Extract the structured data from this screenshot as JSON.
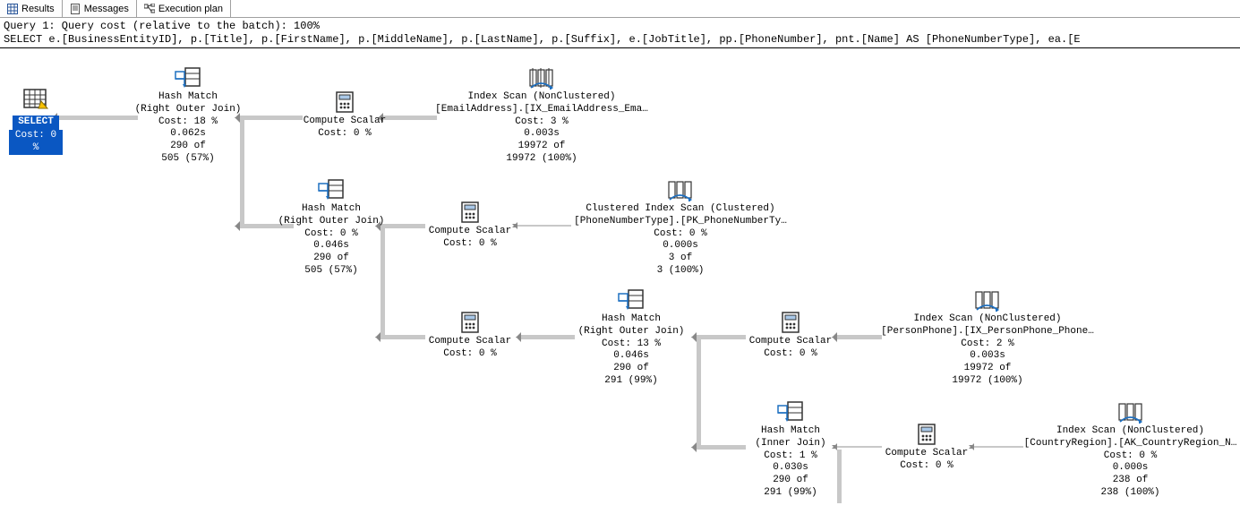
{
  "tabs": {
    "results": "Results",
    "messages": "Messages",
    "execution_plan": "Execution plan"
  },
  "header": {
    "line1": "Query 1: Query cost (relative to the batch): 100%",
    "line2": "SELECT e.[BusinessEntityID], p.[Title], p.[FirstName], p.[MiddleName], p.[LastName], p.[Suffix], e.[JobTitle], pp.[PhoneNumber], pnt.[Name] AS [PhoneNumberType], ea.[E"
  },
  "nodes": {
    "select": {
      "label": "SELECT",
      "cost": "Cost: 0 %"
    },
    "hm1": {
      "l1": "Hash Match",
      "l2": "(Right Outer Join)",
      "l3": "Cost: 18 %",
      "l4": "0.062s",
      "l5": "290 of",
      "l6": "505 (57%)"
    },
    "cs1": {
      "l1": "Compute Scalar",
      "l2": "Cost: 0 %"
    },
    "ixscan1": {
      "l1": "Index Scan (NonClustered)",
      "l2": "[EmailAddress].[IX_EmailAddress_Ema…",
      "l3": "Cost: 3 %",
      "l4": "0.003s",
      "l5": "19972 of",
      "l6": "19972 (100%)"
    },
    "hm2": {
      "l1": "Hash Match",
      "l2": "(Right Outer Join)",
      "l3": "Cost: 0 %",
      "l4": "0.046s",
      "l5": "290 of",
      "l6": "505 (57%)"
    },
    "cs2": {
      "l1": "Compute Scalar",
      "l2": "Cost: 0 %"
    },
    "cixscan": {
      "l1": "Clustered Index Scan (Clustered)",
      "l2": "[PhoneNumberType].[PK_PhoneNumberTy…",
      "l3": "Cost: 0 %",
      "l4": "0.000s",
      "l5": "3 of",
      "l6": "3 (100%)"
    },
    "cs3": {
      "l1": "Compute Scalar",
      "l2": "Cost: 0 %"
    },
    "hm3": {
      "l1": "Hash Match",
      "l2": "(Right Outer Join)",
      "l3": "Cost: 13 %",
      "l4": "0.046s",
      "l5": "290 of",
      "l6": "291 (99%)"
    },
    "cs4": {
      "l1": "Compute Scalar",
      "l2": "Cost: 0 %"
    },
    "ixscan2": {
      "l1": "Index Scan (NonClustered)",
      "l2": "[PersonPhone].[IX_PersonPhone_Phone…",
      "l3": "Cost: 2 %",
      "l4": "0.003s",
      "l5": "19972 of",
      "l6": "19972 (100%)"
    },
    "hm4": {
      "l1": "Hash Match",
      "l2": "(Inner Join)",
      "l3": "Cost: 1 %",
      "l4": "0.030s",
      "l5": "290 of",
      "l6": "291 (99%)"
    },
    "cs5": {
      "l1": "Compute Scalar",
      "l2": "Cost: 0 %"
    },
    "ixscan3": {
      "l1": "Index Scan (NonClustered)",
      "l2": "[CountryRegion].[AK_CountryRegion_N…",
      "l3": "Cost: 0 %",
      "l4": "0.000s",
      "l5": "238 of",
      "l6": "238 (100%)"
    }
  }
}
